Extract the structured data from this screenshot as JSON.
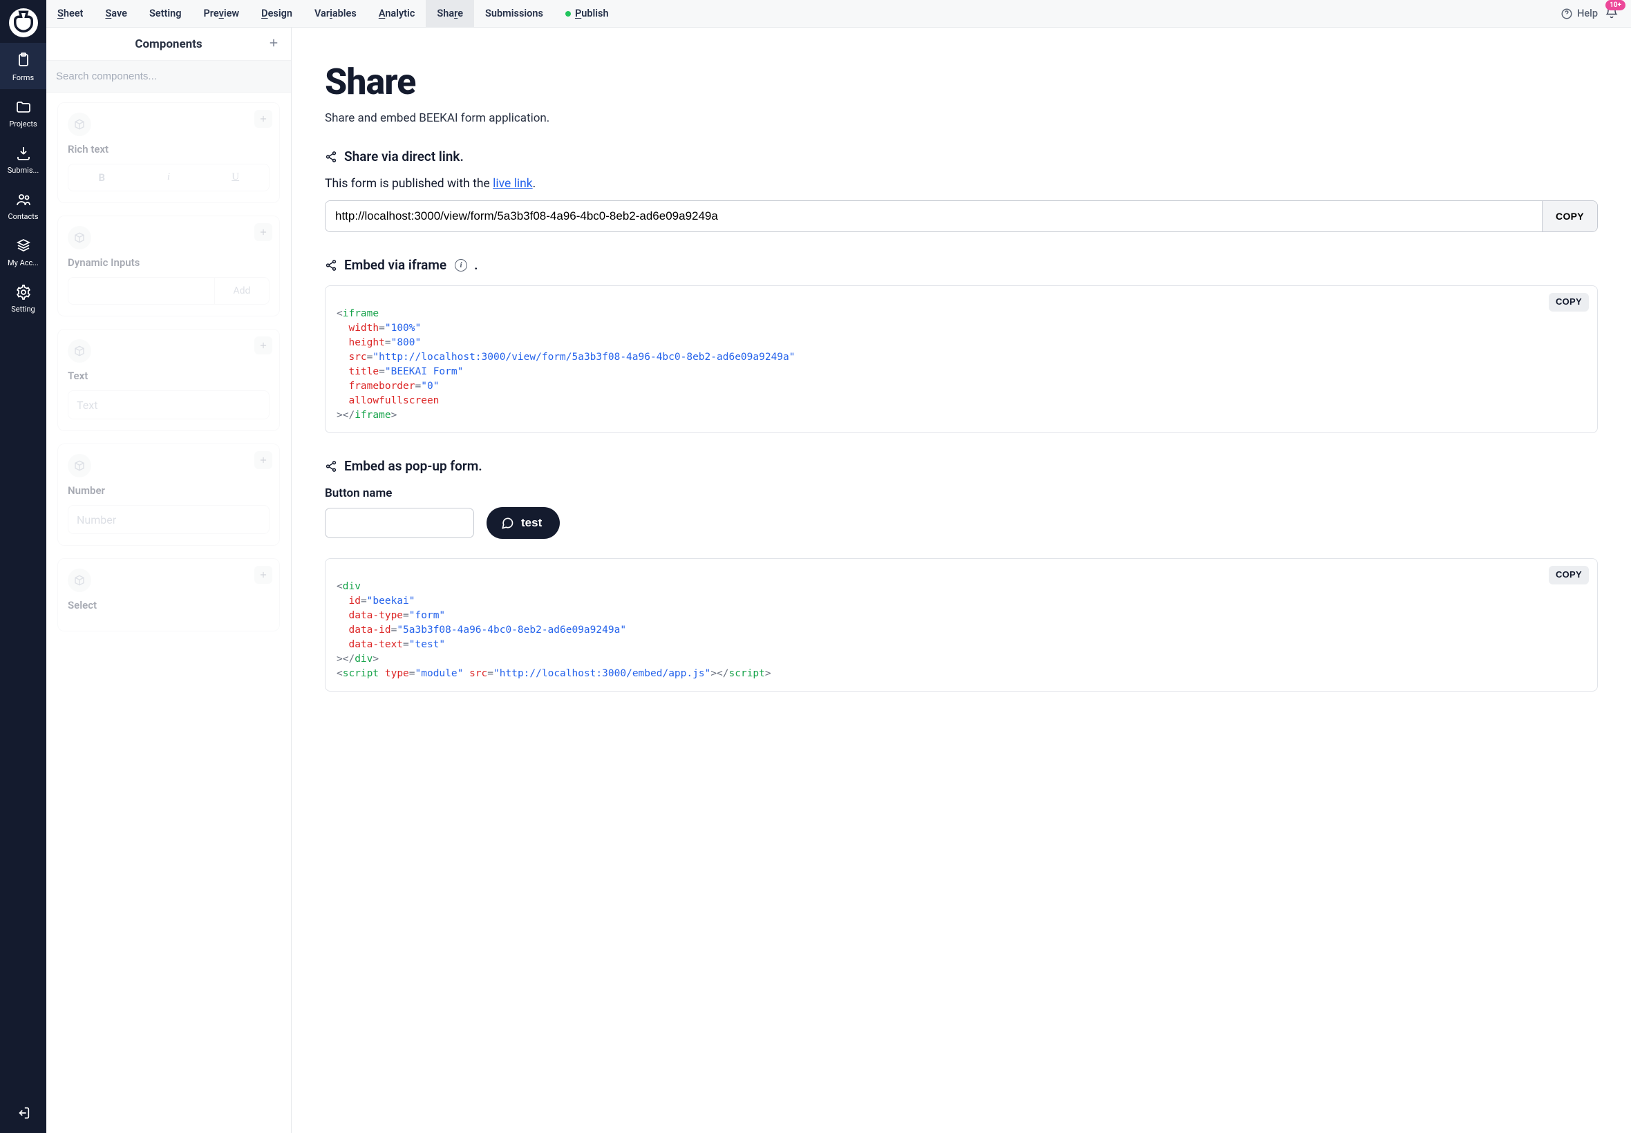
{
  "nav": {
    "items": [
      {
        "label": "Forms"
      },
      {
        "label": "Projects"
      },
      {
        "label": "Submis..."
      },
      {
        "label": "Contacts"
      },
      {
        "label": "My Acc..."
      },
      {
        "label": "Setting"
      }
    ]
  },
  "topbar": {
    "menu": [
      {
        "pre": "S",
        "rest": "heet"
      },
      {
        "pre": "S",
        "rest": "ave"
      },
      {
        "pre": "",
        "rest": "Setting"
      },
      {
        "pre": "",
        "rest": "Pre",
        "mid": "v",
        "rest2": "iew"
      },
      {
        "pre": "D",
        "rest": "esign"
      },
      {
        "pre": "",
        "rest": "Var",
        "mid": "i",
        "rest2": "ables"
      },
      {
        "pre": "A",
        "rest": "nalytic"
      },
      {
        "pre": "",
        "rest": "Sha",
        "mid": "r",
        "rest2": "e"
      },
      {
        "pre": "",
        "rest": "Submissions"
      },
      {
        "pre": "P",
        "rest": "ublish"
      }
    ],
    "help": "Help",
    "badge": "10+"
  },
  "panel": {
    "title": "Components",
    "search_placeholder": "Search components...",
    "cards": {
      "richtext": {
        "title": "Rich text",
        "b": "B",
        "i": "i",
        "u": "U"
      },
      "dynamic": {
        "title": "Dynamic Inputs",
        "add": "Add"
      },
      "text": {
        "title": "Text",
        "ph": "Text"
      },
      "number": {
        "title": "Number",
        "ph": "Number"
      },
      "select": {
        "title": "Select"
      }
    }
  },
  "content": {
    "h1": "Share",
    "sub": "Share and embed BEEKAI form application.",
    "s1_title": "Share via direct link.",
    "pub_prefix": "This form is published with the ",
    "pub_link": "live link",
    "url": "http://localhost:3000/view/form/5a3b3f08-4a96-4bc0-8eb2-ad6e09a9249a",
    "copy": "COPY",
    "s2_title": "Embed via iframe ",
    "iframe": {
      "tag": "iframe",
      "width_attr": "width",
      "width_val": "\"100%\"",
      "height_attr": "height",
      "height_val": "\"800\"",
      "src_attr": "src",
      "src_val": "\"http://localhost:3000/view/form/5a3b3f08-4a96-4bc0-8eb2-ad6e09a9249a\"",
      "title_attr": "title",
      "title_val": "\"BEEKAI Form\"",
      "fb_attr": "frameborder",
      "fb_val": "\"0\"",
      "afs_attr": "allowfullscreen",
      "close": "iframe"
    },
    "s3_title": "Embed as pop-up form.",
    "btn_label": "Button name",
    "btn_text": "test",
    "popup": {
      "div": "div",
      "id_attr": "id",
      "id_val": "\"beekai\"",
      "dt_attr": "data-type",
      "dt_val": "\"form\"",
      "di_attr": "data-id",
      "di_val": "\"5a3b3f08-4a96-4bc0-8eb2-ad6e09a9249a\"",
      "dtx_attr": "data-text",
      "dtx_val": "\"test\"",
      "script": "script",
      "type_attr": "type",
      "type_val": "\"module\"",
      "src_attr": "src",
      "src_val": "\"http://localhost:3000/embed/app.js\""
    }
  }
}
